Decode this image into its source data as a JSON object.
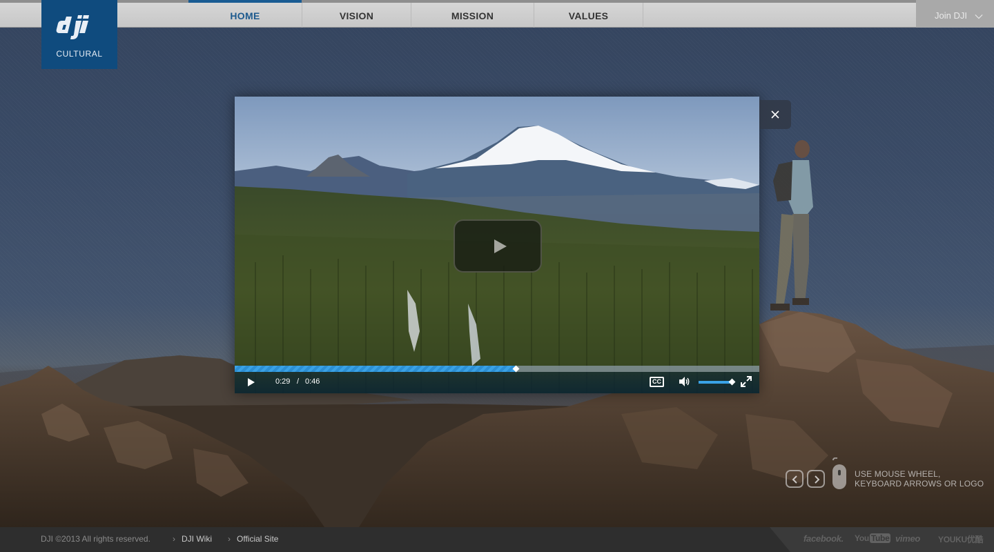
{
  "nav": {
    "items": [
      {
        "label": "HOME",
        "active": true
      },
      {
        "label": "VISION",
        "active": false
      },
      {
        "label": "MISSION",
        "active": false
      },
      {
        "label": "VALUES",
        "active": false
      }
    ],
    "join_label": "Join DJI"
  },
  "logo": {
    "wordmark": "dji",
    "subtitle": "CULTURAL"
  },
  "video": {
    "current_time": "0:29",
    "separator": "/",
    "duration": "0:46",
    "progress_fraction": 0.536,
    "volume_fraction": 0.96,
    "cc_label": "CC",
    "icons": {
      "play": "play-icon",
      "big_play": "big-play-icon",
      "volume": "volume-icon",
      "fullscreen": "fullscreen-icon",
      "close": "close-icon"
    }
  },
  "hint": {
    "line1": "USE MOUSE WHEEL,",
    "line2": "KEYBOARD ARROWS OR LOGO"
  },
  "footer": {
    "copyright": "DJI ©2013 All rights reserved.",
    "links": [
      "DJI Wiki",
      "Official Site"
    ],
    "social": [
      "facebook.",
      "You",
      "Tube",
      "vimeo",
      "YOUKU优酷"
    ]
  },
  "colors": {
    "accent": "#1a5c93",
    "logo_bg": "#0f4b7e",
    "progress": "#3aa2e6"
  }
}
